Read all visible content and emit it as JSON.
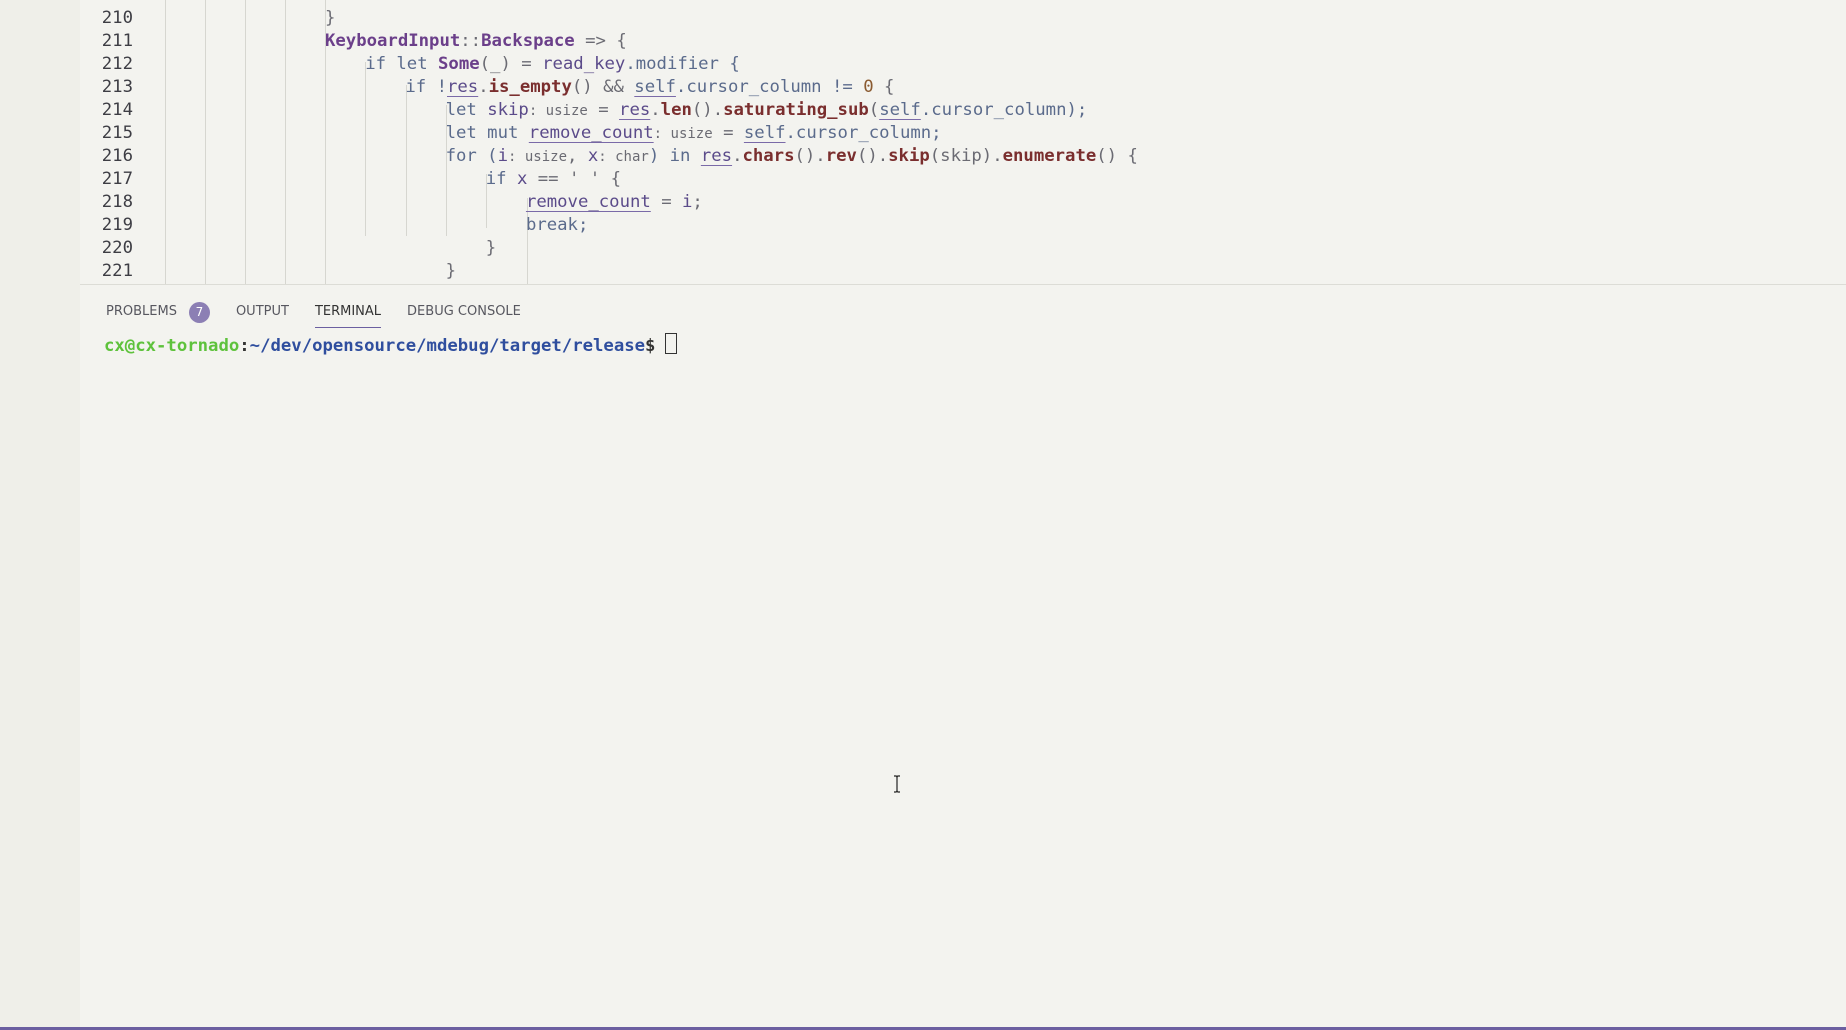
{
  "editor": {
    "partial_top_line": "209",
    "lines": [
      {
        "no": "210",
        "tokens": [
          {
            "t": "}",
            "c": "punc"
          }
        ]
      },
      {
        "no": "211",
        "tokens": [
          {
            "t": "KeyboardInput",
            "c": "ty"
          },
          {
            "t": "::",
            "c": "punc"
          },
          {
            "t": "Backspace",
            "c": "ty"
          },
          {
            "t": " => {",
            "c": "punc"
          }
        ]
      },
      {
        "no": "212",
        "tokens": [
          {
            "t": "if let ",
            "c": "kw"
          },
          {
            "t": "Some",
            "c": "ty"
          },
          {
            "t": "(_) = ",
            "c": "punc"
          },
          {
            "t": "read_key",
            "c": "var"
          },
          {
            "t": ".modifier {",
            "c": "kw"
          }
        ]
      },
      {
        "no": "213",
        "tokens": [
          {
            "t": "if !",
            "c": "kw"
          },
          {
            "t": "res",
            "c": "var ul"
          },
          {
            "t": ".",
            "c": "punc"
          },
          {
            "t": "is_empty",
            "c": "fn"
          },
          {
            "t": "() && ",
            "c": "punc"
          },
          {
            "t": "self",
            "c": "kw ul"
          },
          {
            "t": ".cursor_column != ",
            "c": "kw"
          },
          {
            "t": "0",
            "c": "num"
          },
          {
            "t": " {",
            "c": "punc"
          }
        ]
      },
      {
        "no": "214",
        "tokens": [
          {
            "t": "let ",
            "c": "kw"
          },
          {
            "t": "skip",
            "c": "var"
          },
          {
            "t": ": usize",
            "c": "hint"
          },
          {
            "t": " = ",
            "c": "punc"
          },
          {
            "t": "res",
            "c": "var ul"
          },
          {
            "t": ".",
            "c": "punc"
          },
          {
            "t": "len",
            "c": "fn"
          },
          {
            "t": "().",
            "c": "punc"
          },
          {
            "t": "saturating_sub",
            "c": "fn"
          },
          {
            "t": "(",
            "c": "punc"
          },
          {
            "t": "self",
            "c": "kw ul"
          },
          {
            "t": ".cursor_column);",
            "c": "kw"
          }
        ]
      },
      {
        "no": "215",
        "tokens": [
          {
            "t": "let mut ",
            "c": "kw"
          },
          {
            "t": "remove_count",
            "c": "var ul"
          },
          {
            "t": ": usize",
            "c": "hint"
          },
          {
            "t": " = ",
            "c": "punc"
          },
          {
            "t": "self",
            "c": "kw ul"
          },
          {
            "t": ".cursor_column;",
            "c": "kw"
          }
        ]
      },
      {
        "no": "216",
        "tokens": [
          {
            "t": "for (",
            "c": "kw"
          },
          {
            "t": "i",
            "c": "var"
          },
          {
            "t": ": usize",
            "c": "hint"
          },
          {
            "t": ", ",
            "c": "punc"
          },
          {
            "t": "x",
            "c": "var"
          },
          {
            "t": ": char",
            "c": "hint"
          },
          {
            "t": ") in ",
            "c": "kw"
          },
          {
            "t": "res",
            "c": "var ul"
          },
          {
            "t": ".",
            "c": "punc"
          },
          {
            "t": "chars",
            "c": "fn"
          },
          {
            "t": "().",
            "c": "punc"
          },
          {
            "t": "rev",
            "c": "fn"
          },
          {
            "t": "().",
            "c": "punc"
          },
          {
            "t": "skip",
            "c": "fn"
          },
          {
            "t": "(skip).",
            "c": "punc"
          },
          {
            "t": "enumerate",
            "c": "fn"
          },
          {
            "t": "() {",
            "c": "punc"
          }
        ]
      },
      {
        "no": "217",
        "tokens": [
          {
            "t": "if ",
            "c": "kw"
          },
          {
            "t": "x",
            "c": "var"
          },
          {
            "t": " == ' ' {",
            "c": "punc"
          }
        ]
      },
      {
        "no": "218",
        "tokens": [
          {
            "t": "remove_count",
            "c": "var ul"
          },
          {
            "t": " = ",
            "c": "punc"
          },
          {
            "t": "i",
            "c": "var"
          },
          {
            "t": ";",
            "c": "punc"
          }
        ]
      },
      {
        "no": "219",
        "tokens": [
          {
            "t": "break;",
            "c": "kw"
          }
        ]
      },
      {
        "no": "220",
        "tokens": [
          {
            "t": "}",
            "c": "punc"
          }
        ]
      },
      {
        "no": "221",
        "tokens": [
          {
            "t": "}",
            "c": "punc"
          }
        ]
      }
    ]
  },
  "panel": {
    "tabs": [
      {
        "label": "PROBLEMS",
        "badge": "7",
        "active": false
      },
      {
        "label": "OUTPUT",
        "active": false
      },
      {
        "label": "TERMINAL",
        "active": true
      },
      {
        "label": "DEBUG CONSOLE",
        "active": false
      }
    ],
    "terminal": {
      "user_host": "cx@cx-tornado",
      "separator": ":",
      "path": "~/dev/opensource/mdebug/target/release",
      "prompt_symbol": "$"
    }
  },
  "colors": {
    "background": "#f3f3ef",
    "accent": "#6b5fa0",
    "badge": "#8c7fb4",
    "terminal_user": "#5ec23c",
    "terminal_path": "#2f4e9e"
  }
}
